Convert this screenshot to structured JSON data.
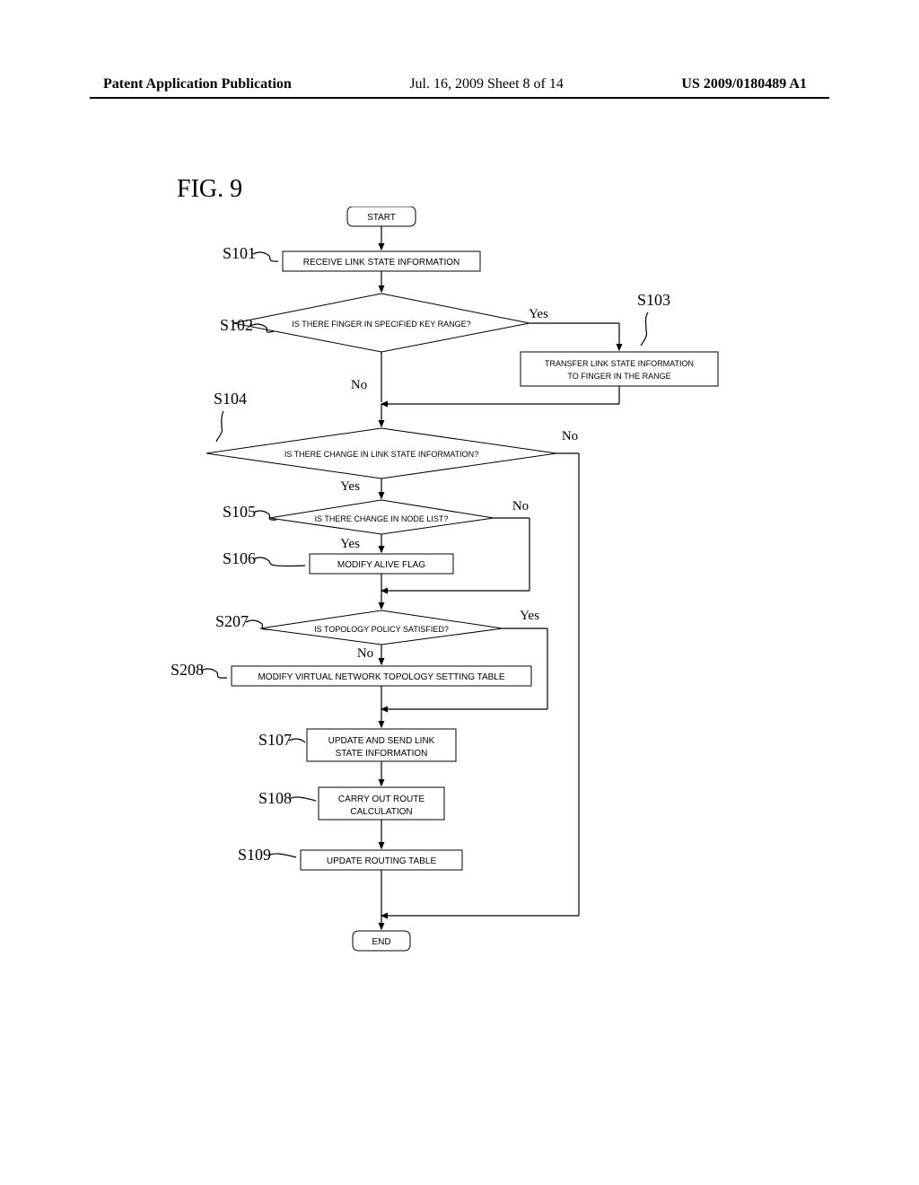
{
  "header": {
    "left": "Patent Application Publication",
    "center": "Jul. 16, 2009  Sheet 8 of 14",
    "right": "US 2009/0180489 A1"
  },
  "fig_title": "FIG. 9",
  "start": "START",
  "end": "END",
  "steps": {
    "S101": {
      "label": "S101",
      "text": "RECEIVE LINK STATE INFORMATION"
    },
    "S102": {
      "label": "S102",
      "text": "IS THERE FINGER IN SPECIFIED KEY RANGE?"
    },
    "S103": {
      "label": "S103",
      "text1": "TRANSFER LINK STATE INFORMATION",
      "text2": "TO FINGER IN THE RANGE"
    },
    "S104": {
      "label": "S104",
      "text": "IS THERE CHANGE IN LINK STATE INFORMATION?"
    },
    "S105": {
      "label": "S105",
      "text": "IS THERE CHANGE IN NODE LIST?"
    },
    "S106": {
      "label": "S106",
      "text": "MODIFY ALIVE FLAG"
    },
    "S207": {
      "label": "S207",
      "text": "IS TOPOLOGY POLICY SATISFIED?"
    },
    "S208": {
      "label": "S208",
      "text": "MODIFY VIRTUAL NETWORK TOPOLOGY SETTING TABLE"
    },
    "S107": {
      "label": "S107",
      "text1": "UPDATE AND SEND LINK",
      "text2": "STATE INFORMATION"
    },
    "S108": {
      "label": "S108",
      "text1": "CARRY OUT ROUTE",
      "text2": "CALCULATION"
    },
    "S109": {
      "label": "S109",
      "text": "UPDATE ROUTING TABLE"
    }
  },
  "branches": {
    "yes": "Yes",
    "no": "No"
  }
}
